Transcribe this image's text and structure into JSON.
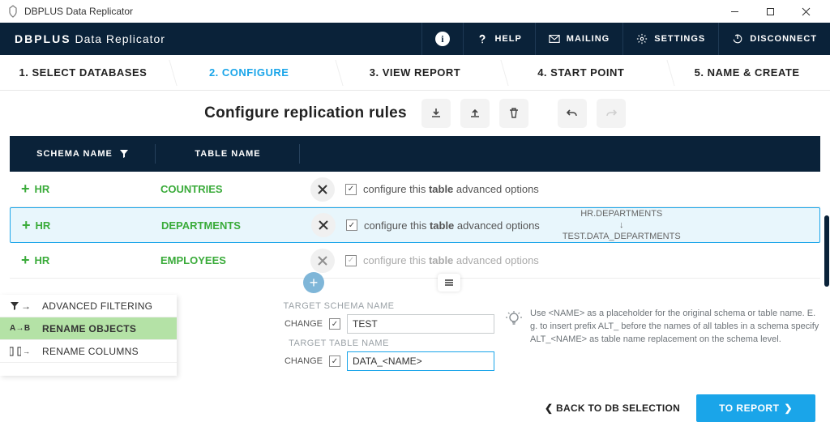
{
  "window_title": "DBPLUS Data Replicator",
  "brand": {
    "bold": "DBPLUS",
    "rest": " Data Replicator"
  },
  "header_buttons": {
    "help": "HELP",
    "mailing": "MAILING",
    "settings": "SETTINGS",
    "disconnect": "DISCONNECT"
  },
  "wizard_steps": [
    "1. SELECT DATABASES",
    "2. CONFIGURE",
    "3. VIEW REPORT",
    "4. START POINT",
    "5. NAME & CREATE"
  ],
  "page_title": "Configure replication rules",
  "table": {
    "headers": {
      "schema": "SCHEMA NAME",
      "table": "TABLE NAME"
    },
    "option_prefix": "configure this ",
    "option_bold": "table",
    "option_suffix": " advanced options",
    "rows": [
      {
        "schema": "HR",
        "table": "COUNTRIES",
        "selected": false,
        "dim": false,
        "mapping_from": "",
        "mapping_to": ""
      },
      {
        "schema": "HR",
        "table": "DEPARTMENTS",
        "selected": true,
        "dim": false,
        "mapping_from": "HR.DEPARTMENTS",
        "mapping_to": "TEST.DATA_DEPARTMENTS"
      },
      {
        "schema": "HR",
        "table": "EMPLOYEES",
        "selected": false,
        "dim": true,
        "mapping_from": "",
        "mapping_to": ""
      }
    ]
  },
  "side_tabs": {
    "adv": "ADVANCED FILTERING",
    "rename_obj": "RENAME OBJECTS",
    "rename_col": "RENAME COLUMNS"
  },
  "rename_form": {
    "schema_label": "TARGET SCHEMA NAME",
    "table_label": "TARGET TABLE NAME",
    "change": "CHANGE",
    "schema_value": "TEST",
    "table_value": "DATA_<NAME>"
  },
  "tip": "Use <NAME> as a placeholder for the original schema or table name. E. g. to insert prefix ALT_ before the names of all tables in a schema specify ALT_<NAME> as table name replacement on the schema level.",
  "footer": {
    "back": "BACK TO DB SELECTION",
    "next": "TO REPORT"
  }
}
